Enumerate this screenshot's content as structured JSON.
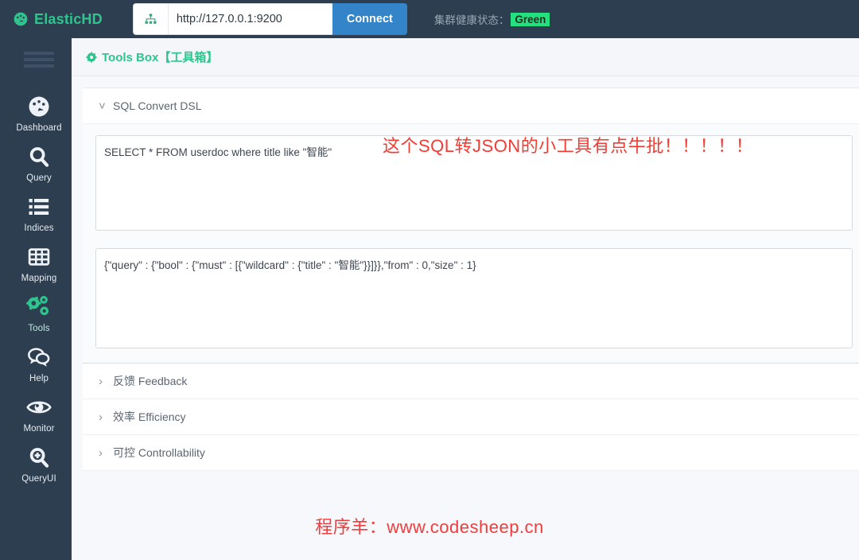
{
  "topbar": {
    "brand": "ElasticHD",
    "brand_icon": "dashboard-speedometer-icon",
    "url_icon": "sitemap-icon",
    "url_value": "http://127.0.0.1:9200",
    "url_placeholder": "http://127.0.0.1:9200",
    "connect_label": "Connect",
    "health_label": "集群健康状态：",
    "health_status": "Green",
    "health_color": "#25e07f",
    "accent_color": "#2fc48d",
    "bar_color": "#2d3e50",
    "connect_color": "#3384c8"
  },
  "sidebar": {
    "menu_icon": "hamburger-icon",
    "items": [
      {
        "label": "Dashboard",
        "icon": "speedometer-icon",
        "active": false
      },
      {
        "label": "Query",
        "icon": "magnifier-icon",
        "active": false
      },
      {
        "label": "Indices",
        "icon": "list-icon",
        "active": false
      },
      {
        "label": "Mapping",
        "icon": "grid-table-icon",
        "active": false
      },
      {
        "label": "Tools",
        "icon": "gears-icon",
        "active": true
      },
      {
        "label": "Help",
        "icon": "chat-bubbles-icon",
        "active": false
      },
      {
        "label": "Monitor",
        "icon": "eye-icon",
        "active": false
      },
      {
        "label": "QueryUI",
        "icon": "magnifier-plus-icon",
        "active": false
      }
    ]
  },
  "page": {
    "title": "Tools Box【工具箱】",
    "title_icon": "gear-icon"
  },
  "sections": [
    {
      "label": "SQL Convert DSL",
      "chevron": "chevron-down-icon",
      "expanded": true
    },
    {
      "label": "反馈 Feedback",
      "chevron": "chevron-right-icon",
      "expanded": false
    },
    {
      "label": "效率 Efficiency",
      "chevron": "chevron-right-icon",
      "expanded": false
    },
    {
      "label": "可控 Controllability",
      "chevron": "chevron-right-icon",
      "expanded": false
    }
  ],
  "sql_convert": {
    "sql_input": "SELECT * FROM userdoc where title like \"智能\"",
    "sql_placeholder": "",
    "dsl_output": "{\"query\" : {\"bool\" : {\"must\" : [{\"wildcard\" : {\"title\" : \"智能\"}}]}},\"from\" : 0,\"size\" : 1}",
    "dsl_placeholder": ""
  },
  "annotations": {
    "note": "这个SQL转JSON的小工具有点牛批！！！！！",
    "note_color": "#f43b32",
    "watermark": "程序羊：www.codesheep.cn",
    "watermark_color": "#ef3c3c"
  }
}
